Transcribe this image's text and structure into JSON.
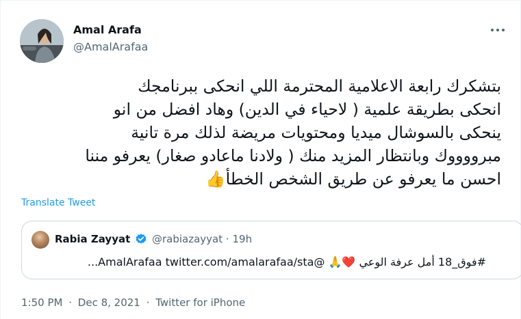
{
  "author": {
    "name": "Amal Arafa",
    "handle": "@AmalArafaa"
  },
  "tweet": {
    "text": "بتشكرك رابعة الاعلامية المحترمة اللي انحكى ببرنامجك\nانحكى بطريقة علمية ( لاحياء في الدين) وهاد افضل من انو\nينحكى بالسوشال ميديا ومحتويات مريضة لذلك مرة تانية\nمبرووووك وبانتظار المزيد منك ( ولادنا ماعادو صغار) يعرفو مننا\nاحسن ما يعرفو عن طريق الشخص الخطأ👍",
    "translate_label": "Translate Tweet"
  },
  "quote": {
    "name": "Rabia Zayyat",
    "handle": "@rabiazayyat",
    "separator": "·",
    "time": "19h",
    "text": "#فوق_18 أمل عرفة الوعي ❤️🙏 @AmalArafaa twitter.com/amalarafaa/sta..."
  },
  "meta": {
    "time": "1:50 PM",
    "sep1": "·",
    "date": "Dec 8, 2021",
    "sep2": "·",
    "source": "Twitter for iPhone"
  },
  "icons": {
    "more": "more-dots-icon",
    "verified": "verified-badge-icon"
  },
  "colors": {
    "link": "#1d9bf0",
    "secondary_text": "#536471",
    "border": "#cfd9de",
    "verified": "#1d9bf0"
  }
}
